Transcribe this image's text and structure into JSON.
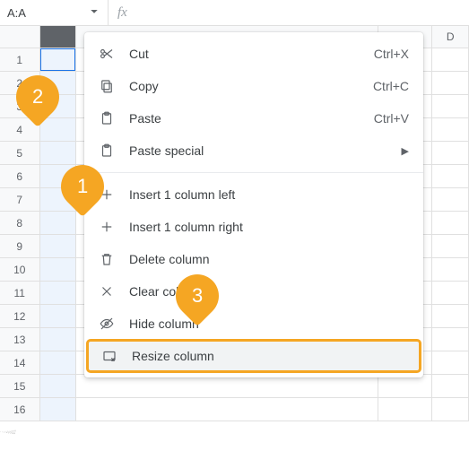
{
  "namebox": {
    "value": "A:A"
  },
  "fx": {
    "label": "fx"
  },
  "columns": {
    "a": "",
    "b": "",
    "c": "",
    "d": "D"
  },
  "rows": [
    "1",
    "2",
    "3",
    "4",
    "5",
    "6",
    "7",
    "8",
    "9",
    "10",
    "11",
    "12",
    "13",
    "14",
    "15",
    "16"
  ],
  "menu": {
    "cut": {
      "label": "Cut",
      "shortcut": "Ctrl+X"
    },
    "copy": {
      "label": "Copy",
      "shortcut": "Ctrl+C"
    },
    "paste": {
      "label": "Paste",
      "shortcut": "Ctrl+V"
    },
    "paste_special": {
      "label": "Paste special"
    },
    "insert_left": {
      "label": "Insert 1 column left"
    },
    "insert_right": {
      "label": "Insert 1 column right"
    },
    "delete": {
      "label": "Delete column"
    },
    "clear": {
      "label": "Clear column"
    },
    "hide": {
      "label": "Hide column"
    },
    "resize": {
      "label": "Resize column"
    }
  },
  "annotations": {
    "b1": "1",
    "b2": "2",
    "b3": "3"
  }
}
